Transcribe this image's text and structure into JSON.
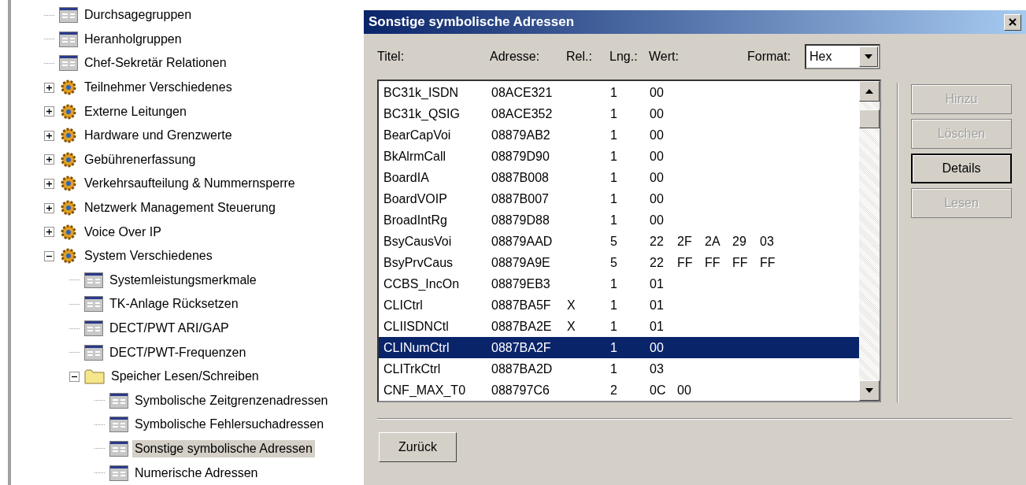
{
  "tree": {
    "items": [
      {
        "label": "Durchsagegruppen",
        "kind": "form",
        "selected": false
      },
      {
        "label": "Heranholgruppen",
        "kind": "form",
        "selected": false
      },
      {
        "label": "Chef-Sekretär Relationen",
        "kind": "form",
        "selected": false
      },
      {
        "label": "Teilnehmer Verschiedenes",
        "kind": "category",
        "expanded": false,
        "selected": false
      },
      {
        "label": "Externe Leitungen",
        "kind": "category",
        "expanded": false,
        "selected": false
      },
      {
        "label": "Hardware und Grenzwerte",
        "kind": "category",
        "expanded": false,
        "selected": false
      },
      {
        "label": "Gebührenerfassung",
        "kind": "category",
        "expanded": false,
        "selected": false
      },
      {
        "label": "Verkehrsaufteilung & Nummernsperre",
        "kind": "category",
        "expanded": false,
        "selected": false
      },
      {
        "label": "Netzwerk Management Steuerung",
        "kind": "category",
        "expanded": false,
        "selected": false
      },
      {
        "label": "Voice Over IP",
        "kind": "category",
        "expanded": false,
        "selected": false
      },
      {
        "label": "System Verschiedenes",
        "kind": "category",
        "expanded": true,
        "selected": false,
        "children": [
          {
            "label": "Systemleistungsmerkmale",
            "kind": "form",
            "selected": false
          },
          {
            "label": "TK-Anlage Rücksetzen",
            "kind": "form",
            "selected": false
          },
          {
            "label": "DECT/PWT ARI/GAP",
            "kind": "form",
            "selected": false
          },
          {
            "label": "DECT/PWT-Frequenzen",
            "kind": "form",
            "selected": false
          },
          {
            "label": "Speicher Lesen/Schreiben",
            "kind": "folder",
            "expanded": true,
            "selected": false,
            "children": [
              {
                "label": "Symbolische Zeitgrenzenadressen",
                "kind": "form",
                "selected": false
              },
              {
                "label": "Symbolische Fehlersuchadressen",
                "kind": "form",
                "selected": false
              },
              {
                "label": "Sonstige symbolische Adressen",
                "kind": "form",
                "selected": true
              },
              {
                "label": "Numerische Adressen",
                "kind": "form",
                "selected": false
              }
            ]
          }
        ]
      }
    ]
  },
  "dialog": {
    "title": "Sonstige symbolische Adressen",
    "columns": [
      "Titel:",
      "Adresse:",
      "Rel.:",
      "Lng.:",
      "Wert:"
    ],
    "format": {
      "label": "Format:",
      "value": "Hex"
    },
    "rows": [
      {
        "title": "BC31k_ISDN",
        "address": "08ACE321",
        "rel": "",
        "length": "1",
        "values": [
          "00"
        ],
        "selected": false
      },
      {
        "title": "BC31k_QSIG",
        "address": "08ACE352",
        "rel": "",
        "length": "1",
        "values": [
          "00"
        ],
        "selected": false
      },
      {
        "title": "BearCapVoi",
        "address": "08879AB2",
        "rel": "",
        "length": "1",
        "values": [
          "00"
        ],
        "selected": false
      },
      {
        "title": "BkAlrmCall",
        "address": "08879D90",
        "rel": "",
        "length": "1",
        "values": [
          "00"
        ],
        "selected": false
      },
      {
        "title": "BoardIA",
        "address": "0887B008",
        "rel": "",
        "length": "1",
        "values": [
          "00"
        ],
        "selected": false
      },
      {
        "title": "BoardVOIP",
        "address": "0887B007",
        "rel": "",
        "length": "1",
        "values": [
          "00"
        ],
        "selected": false
      },
      {
        "title": "BroadIntRg",
        "address": "08879D88",
        "rel": "",
        "length": "1",
        "values": [
          "00"
        ],
        "selected": false
      },
      {
        "title": "BsyCausVoi",
        "address": "08879AAD",
        "rel": "",
        "length": "5",
        "values": [
          "22",
          "2F",
          "2A",
          "29",
          "03"
        ],
        "selected": false
      },
      {
        "title": "BsyPrvCaus",
        "address": "08879A9E",
        "rel": "",
        "length": "5",
        "values": [
          "22",
          "FF",
          "FF",
          "FF",
          "FF"
        ],
        "selected": false
      },
      {
        "title": "CCBS_IncOn",
        "address": "08879EB3",
        "rel": "",
        "length": "1",
        "values": [
          "01"
        ],
        "selected": false
      },
      {
        "title": "CLICtrl",
        "address": "0887BA5F",
        "rel": "X",
        "length": "1",
        "values": [
          "01"
        ],
        "selected": false
      },
      {
        "title": "CLIISDNCtl",
        "address": "0887BA2E",
        "rel": "X",
        "length": "1",
        "values": [
          "01"
        ],
        "selected": false
      },
      {
        "title": "CLINumCtrl",
        "address": "0887BA2F",
        "rel": "",
        "length": "1",
        "values": [
          "00"
        ],
        "selected": true
      },
      {
        "title": "CLITrkCtrl",
        "address": "0887BA2D",
        "rel": "",
        "length": "1",
        "values": [
          "03"
        ],
        "selected": false
      },
      {
        "title": "CNF_MAX_T0",
        "address": "088797C6",
        "rel": "",
        "length": "2",
        "values": [
          "0C",
          "00"
        ],
        "selected": false
      }
    ],
    "side_buttons": [
      {
        "label": "Hinzu",
        "disabled": true,
        "default": false
      },
      {
        "label": "Löschen",
        "disabled": true,
        "default": false
      },
      {
        "label": "Details",
        "disabled": false,
        "default": true
      },
      {
        "label": "Lesen",
        "disabled": true,
        "default": false
      }
    ],
    "back_button": "Zurück"
  }
}
